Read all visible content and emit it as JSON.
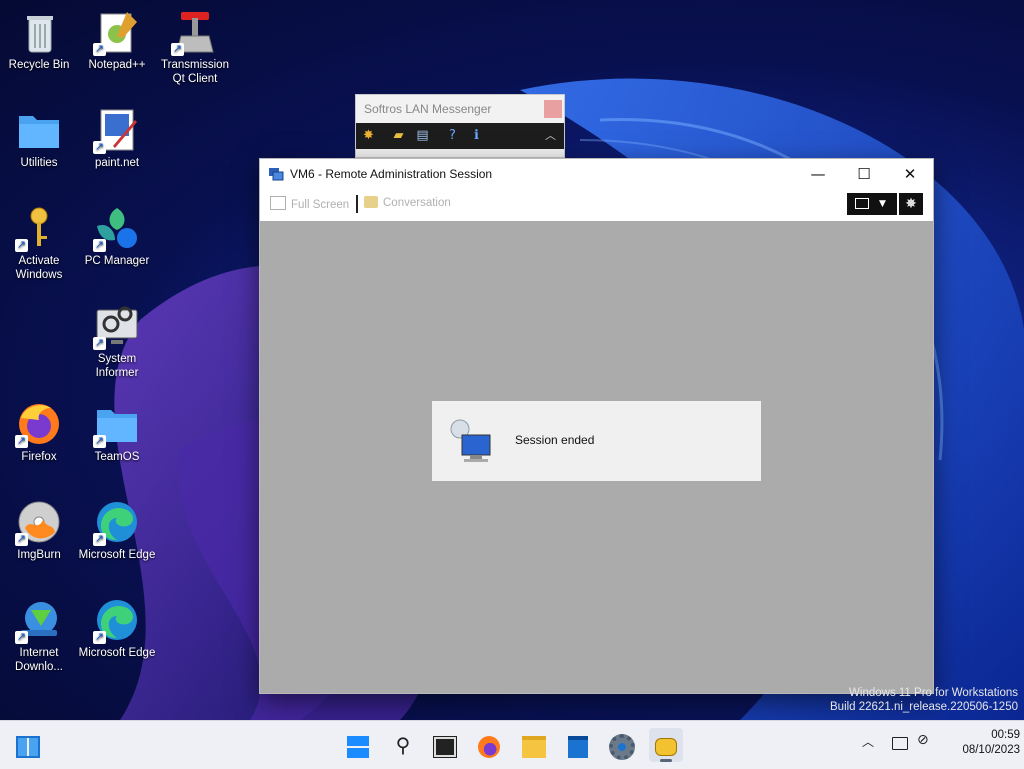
{
  "desktop": {
    "icons": [
      {
        "label": "Recycle Bin"
      },
      {
        "label": "Notepad++"
      },
      {
        "label": "Transmission Qt Client"
      },
      {
        "label": "Utilities"
      },
      {
        "label": "paint.net"
      },
      {
        "label": "Activate Windows"
      },
      {
        "label": "PC Manager"
      },
      {
        "label": "System Informer"
      },
      {
        "label": "Firefox"
      },
      {
        "label": "TeamOS"
      },
      {
        "label": "ImgBurn"
      },
      {
        "label": "Microsoft Edge"
      },
      {
        "label": "Internet Downlo..."
      },
      {
        "label": "Microsoft Edge"
      }
    ],
    "watermark": {
      "line1": "Windows 11 Pro for Workstations",
      "line2": "Build 22621.ni_release.220506-1250"
    }
  },
  "messenger": {
    "title": "Softros LAN Messenger"
  },
  "window": {
    "title": "VM6 - Remote Administration Session",
    "toolbar": {
      "full_screen": "Full Screen",
      "conversation": "Conversation"
    },
    "dialog": {
      "message": "Session ended"
    }
  },
  "taskbar": {
    "time": "00:59",
    "date": "08/10/2023"
  },
  "colors": {
    "taskbar": "#eef0f6",
    "session_bg": "#ababab",
    "accent": "#0067c0"
  }
}
